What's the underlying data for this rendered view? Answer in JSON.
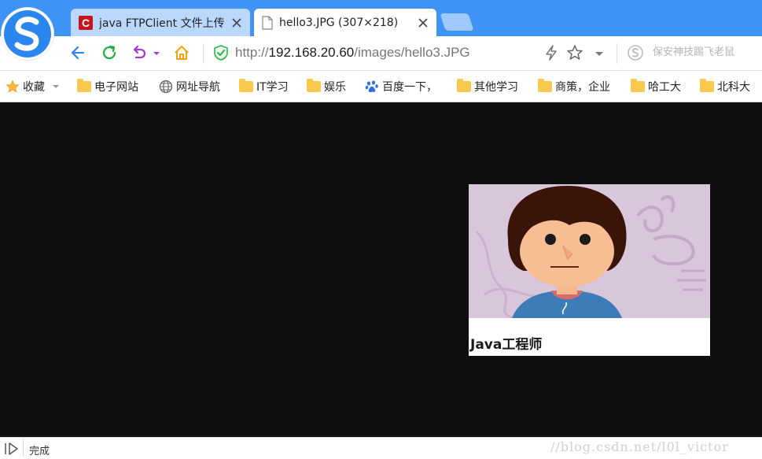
{
  "tabs": [
    {
      "title": "java FTPClient 文件上传",
      "favicon": "csdn-icon",
      "active": false
    },
    {
      "title": "hello3.JPG (307×218)",
      "favicon": "document-icon",
      "active": true
    }
  ],
  "address": {
    "scheme": "http://",
    "host": "192.168.20.60",
    "path": "/images/hello3.JPG"
  },
  "extension_text": "保安神技踢飞老鼠",
  "bookmarks": [
    {
      "label": "收藏",
      "icon": "star-icon"
    },
    {
      "label": "电子网站",
      "icon": "folder-icon"
    },
    {
      "label": "网址导航",
      "icon": "globe-icon"
    },
    {
      "label": "IT学习",
      "icon": "folder-icon"
    },
    {
      "label": "娱乐",
      "icon": "folder-icon"
    },
    {
      "label": "百度一下，",
      "icon": "baidu-paw-icon"
    },
    {
      "label": "其他学习",
      "icon": "folder-icon"
    },
    {
      "label": "商策，企业",
      "icon": "folder-icon"
    },
    {
      "label": "哈工大",
      "icon": "folder-icon"
    },
    {
      "label": "北科大",
      "icon": "folder-icon"
    }
  ],
  "image": {
    "caption": "Java工程师"
  },
  "status": {
    "text": "完成",
    "watermark": "//blog.csdn.net/l0l_victor"
  },
  "colors": {
    "tabstrip": "#3e93f5",
    "viewport_bg": "#0e0e0e",
    "accent": "#3e93f5"
  }
}
